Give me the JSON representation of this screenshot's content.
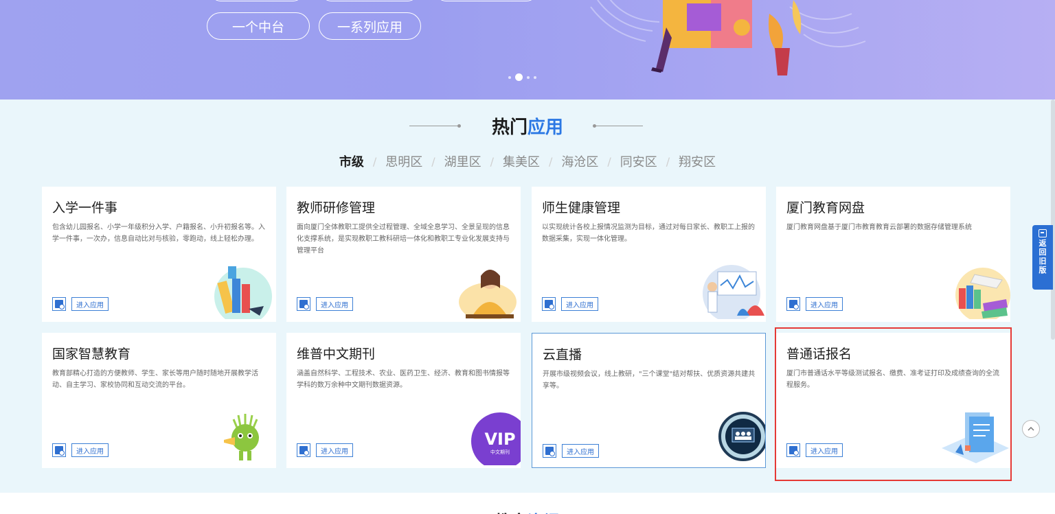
{
  "banner": {
    "pills": [
      "一个中台",
      "一系列应用"
    ],
    "carousel": {
      "count": 4,
      "active_index": 1
    }
  },
  "section": {
    "title_part1": "热门",
    "title_part2": "应用"
  },
  "districts": [
    {
      "label": "市级",
      "active": true
    },
    {
      "label": "思明区",
      "active": false
    },
    {
      "label": "湖里区",
      "active": false
    },
    {
      "label": "集美区",
      "active": false
    },
    {
      "label": "海沧区",
      "active": false
    },
    {
      "label": "同安区",
      "active": false
    },
    {
      "label": "翔安区",
      "active": false
    }
  ],
  "enter_label": "进入应用",
  "apps": [
    {
      "title": "入学一件事",
      "desc": "包含幼儿园报名、小学一年级积分入学、户籍报名、小升初报名等。入学一件事，一次办，信息自动比对与核验，零跑动，线上轻松办理。",
      "icon": "books-illustration-icon"
    },
    {
      "title": "教师研修管理",
      "desc": "面向厦门全体教职工提供全过程管理、全域全息学习、全景呈现的信息化支撑系统，是实现教职工教科研培一体化和教职工专业化发展支持与管理平台",
      "icon": "teacher-illustration-icon"
    },
    {
      "title": "师生健康管理",
      "desc": "以实现统计各校上报情况监测为目标，通过对每日家长、教职工上报的数据采集，实现一体化管理。",
      "icon": "health-illustration-icon"
    },
    {
      "title": "厦门教育网盘",
      "desc": "厦门教育网盘基于厦门市教育教育云部署的数据存储管理系统",
      "icon": "netdisk-books-icon"
    },
    {
      "title": "国家智慧教育",
      "desc": "教育部精心打造的方便教师、学生、家长等用户随时随地开展教学活动、自主学习、家校协同和互动交流的平台。",
      "icon": "mascot-icon"
    },
    {
      "title": "维普中文期刊",
      "desc": "涵盖自然科学、工程技术、农业、医药卫生、经济、教育和图书情报等学科的数万余种中文期刊数据资源。",
      "icon": "vip-logo-icon",
      "logo_text": "VIP",
      "logo_sub": "中文期刊"
    },
    {
      "title": "云直播",
      "desc": "开展市级视频会议，线上教研，\"三个课堂\"结对帮扶、优质资源共建共享等。",
      "icon": "live-stream-icon"
    },
    {
      "title": "普通话报名",
      "desc": "厦门市普通话水平等级测试报名、缴费、准考证打印及成绩查询的全流程服务。",
      "icon": "document-illustration-icon"
    }
  ],
  "sidebar": {
    "back_old_label": "返回旧版"
  },
  "next_section": {
    "title_part1": "教育",
    "title_part2": "资讯"
  },
  "colors": {
    "accent": "#2b78e4",
    "banner": "#9fa2f0",
    "highlight": "#e53935"
  }
}
